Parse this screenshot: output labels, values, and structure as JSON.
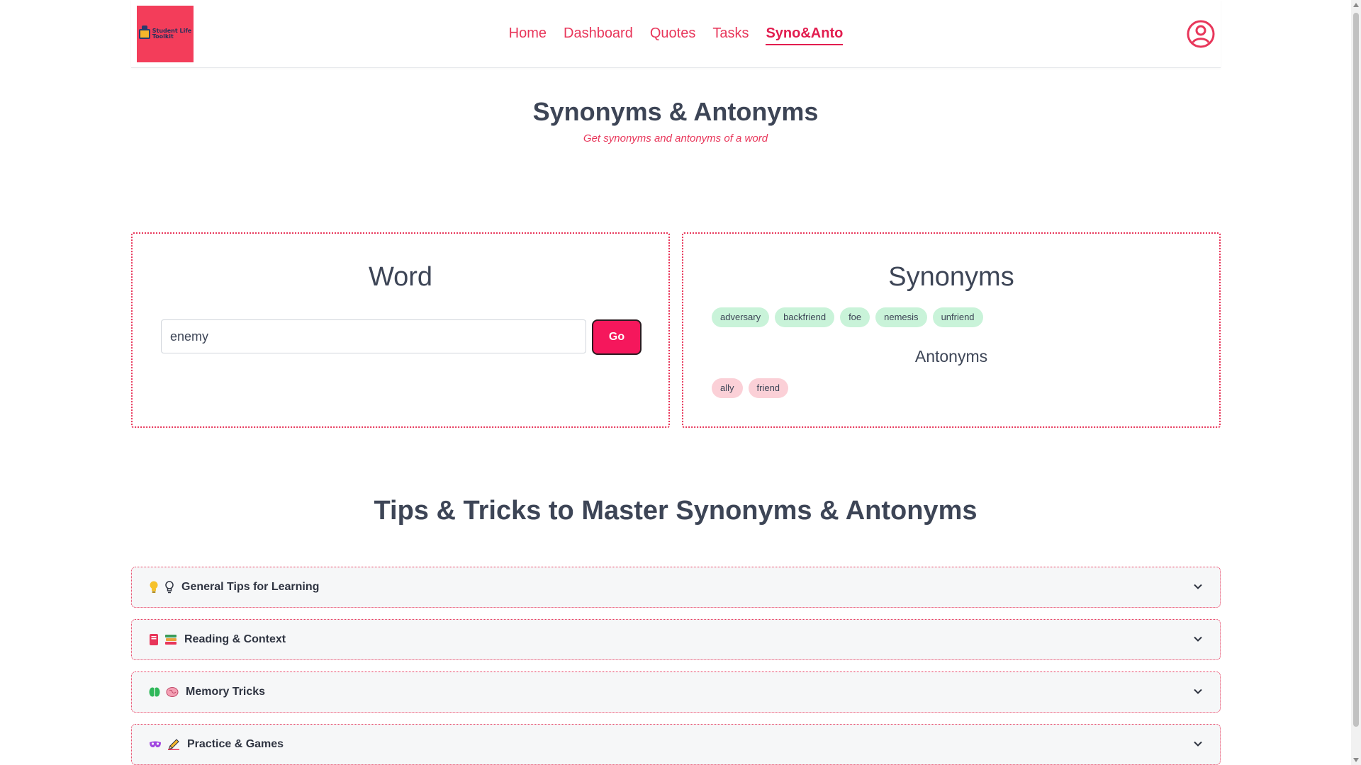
{
  "nav": {
    "logo_text_line1": "Student Life",
    "logo_text_line2": "Toolkit",
    "links": [
      "Home",
      "Dashboard",
      "Quotes",
      "Tasks",
      "Syno&Anto"
    ],
    "active_link": "Syno&Anto"
  },
  "header": {
    "title": "Synonyms & Antonyms",
    "subtitle": "Get synonyms and antonyms of a word"
  },
  "word_card": {
    "heading": "Word",
    "input_value": "enemy",
    "go_label": "Go"
  },
  "results_card": {
    "synonyms_heading": "Synonyms",
    "synonyms": [
      "adversary",
      "backfriend",
      "foe",
      "nemesis",
      "unfriend"
    ],
    "antonyms_heading": "Antonyms",
    "antonyms": [
      "ally",
      "friend"
    ]
  },
  "tips": {
    "title": "Tips & Tricks to Master Synonyms & Antonyms",
    "sections": [
      {
        "label": "General Tips for Learning",
        "icons": [
          "lightbulb-icon",
          "lightbulb-outline-icon"
        ]
      },
      {
        "label": "Reading & Context",
        "icons": [
          "book-icon",
          "books-icon"
        ]
      },
      {
        "label": "Memory Tricks",
        "icons": [
          "brain-icon",
          "brain-pink-icon"
        ]
      },
      {
        "label": "Practice & Games",
        "icons": [
          "mask-icon",
          "pencil-icon"
        ]
      }
    ]
  },
  "colors": {
    "accent": "#e8365a",
    "go_button": "#f5175c",
    "synonym_tag": "#c9f3d9",
    "antonym_tag": "#fbd0d7",
    "text": "#3d4556"
  }
}
